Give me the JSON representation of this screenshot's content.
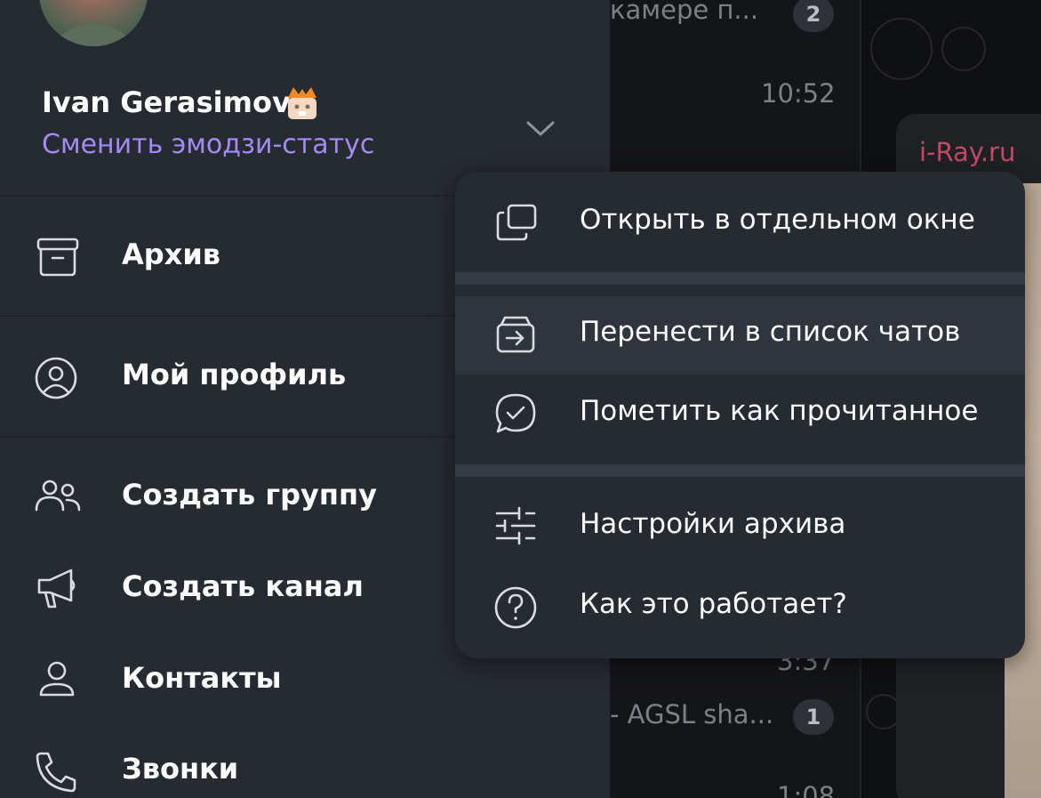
{
  "profile": {
    "name": "Ivan Gerasimov",
    "emoji_status_link": "Сменить эмодзи-статус",
    "icons": {
      "avatar": "avatar-photo",
      "status": "status-emoji-icon",
      "toggle": "chevron-down-icon"
    }
  },
  "sidebar": {
    "items": [
      {
        "label": "Архив",
        "icon": "archive-icon"
      },
      {
        "label": "Мой профиль",
        "icon": "profile-icon"
      },
      {
        "label": "Создать группу",
        "icon": "group-icon"
      },
      {
        "label": "Создать канал",
        "icon": "megaphone-icon"
      },
      {
        "label": "Контакты",
        "icon": "contact-icon"
      },
      {
        "label": "Звонки",
        "icon": "phone-icon"
      }
    ]
  },
  "context_menu": {
    "items": [
      {
        "label": "Открыть в отдельном окне",
        "icon": "new-window-icon"
      },
      {
        "label": "Перенести в список чатов",
        "icon": "move-to-chats-icon"
      },
      {
        "label": "Пометить как прочитанное",
        "icon": "mark-read-icon"
      },
      {
        "label": "Настройки архива",
        "icon": "settings-sliders-icon"
      },
      {
        "label": "Как это работает?",
        "icon": "help-icon"
      }
    ]
  },
  "background": {
    "chat_list": [
      {
        "preview": "камере п...",
        "badge": "2"
      },
      {
        "time": "10:52"
      },
      {
        "time": "3:37"
      },
      {
        "preview": "- AGSL sha...",
        "badge": "1"
      },
      {
        "time": "1:08"
      }
    ],
    "chat_sender": "i-Ray.ru"
  },
  "colors": {
    "sidebar_bg": "#262a31",
    "link": "#a38bf3",
    "menu_hover": "#30353d",
    "sender": "#c04b63"
  }
}
